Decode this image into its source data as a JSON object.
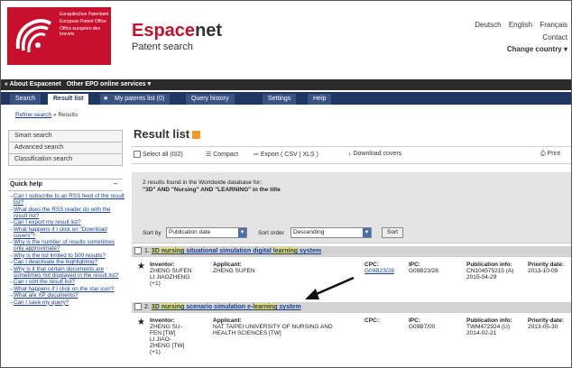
{
  "header": {
    "logo_lines": [
      "Europäisches Patentamt",
      "European Patent Office",
      "Office européen des brevets"
    ],
    "brand_part1": "Espace",
    "brand_part2": "net",
    "brand_sub": "Patent search",
    "languages": [
      "Deutsch",
      "English",
      "Français"
    ],
    "contact": "Contact",
    "change_country": "Change country ▾"
  },
  "topnav": {
    "about": "« About Espacenet",
    "other": "Other EPO online services ▾"
  },
  "tabs": [
    "Search",
    "Result list",
    "My patents list (0)",
    "Query history",
    "Settings",
    "Help"
  ],
  "breadcrumb": {
    "refine": "Refine search",
    "sep": "»",
    "current": "Results"
  },
  "sidebar": {
    "items": [
      "Smart search",
      "Advanced search",
      "Classification search"
    ],
    "quick_help_label": "Quick help",
    "collapse": "–",
    "help_links": [
      "Can I subscribe to an RSS feed of the result list?",
      "What does the RSS reader do with the result list?",
      "Can I export my result list?",
      "What happens if I click on \"Download covers\"?",
      "Why is the number of results sometimes only approximate?",
      "Why is the list limited to 500 results?",
      "Can I deactivate the highlighting?",
      "Why is it that certain documents are sometimes not displayed in the result list?",
      "Can I sort the result list?",
      "What happens if I click on the star icon?",
      "What are XP documents?",
      "Can I save my query?"
    ]
  },
  "main": {
    "title": "Result list",
    "toolbar": {
      "select_all": "Select all",
      "count": "(0/2)",
      "compact": "Compact",
      "export": "Export ( CSV | XLS )",
      "download": "Download covers",
      "print": "Print"
    },
    "summary_line1": "2 results found in the Worldwide database for:",
    "summary_line2": "\"3D\" AND \"Nursing\" AND \"LEARNING\" in the title",
    "sort_by_label": "Sort by",
    "sort_by_value": "Publication date",
    "sort_order_label": "Sort order",
    "sort_order_value": "Descending",
    "sort_button": "Sort"
  },
  "results": [
    {
      "num": "1.",
      "title_parts": [
        {
          "text": "3D",
          "hl": true
        },
        {
          "text": " ",
          "hl": false
        },
        {
          "text": "nursing",
          "hl": true
        },
        {
          "text": " situational simulation digital ",
          "hl": false
        },
        {
          "text": "learning",
          "hl": true
        },
        {
          "text": " system",
          "hl": false
        }
      ],
      "inventor_label": "Inventor:",
      "inventor": [
        "ZHENG SUFEN",
        "LI JIAOZHENG",
        "(+1)"
      ],
      "applicant_label": "Applicant:",
      "applicant": [
        "ZHENG SUFEN"
      ],
      "cpc_label": "CPC:",
      "cpc": [
        "G09B23/28"
      ],
      "ipc_label": "IPC:",
      "ipc": [
        "G09B23/28"
      ],
      "pub_label": "Publication info:",
      "pub": [
        "CN104575215 (A)",
        "2015-04-29"
      ],
      "prio_label": "Priority date:",
      "prio": "2013-10-09"
    },
    {
      "num": "2.",
      "title_parts": [
        {
          "text": "3D",
          "hl": true
        },
        {
          "text": " ",
          "hl": false
        },
        {
          "text": "nursing",
          "hl": true
        },
        {
          "text": " scenario simulation e-",
          "hl": false
        },
        {
          "text": "learning",
          "hl": true
        },
        {
          "text": " system",
          "hl": false
        }
      ],
      "inventor_label": "Inventor:",
      "inventor": [
        "ZHENG SU-",
        "FEN [TW]",
        "LI JIAO-",
        "ZHENG [TW]",
        "(+1)"
      ],
      "applicant_label": "Applicant:",
      "applicant": [
        "NAT TAIPEI UNIVERSITY OF NURSING AND",
        "HEALTH SCIENCES [TW]"
      ],
      "cpc_label": "CPC:",
      "cpc": [],
      "ipc_label": "IPC:",
      "ipc": [
        "G09B7/00"
      ],
      "pub_label": "Publication info:",
      "pub": [
        "TWM472924 (U)",
        "2014-02-21"
      ],
      "prio_label": "Priority date:",
      "prio": "2013-05-30"
    }
  ]
}
